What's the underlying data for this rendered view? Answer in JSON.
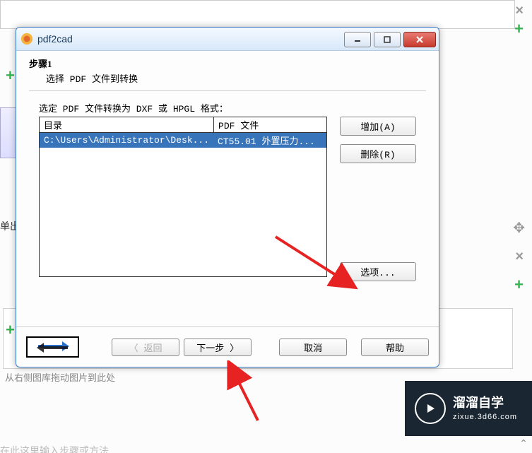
{
  "background": {
    "dropzone_hint": "从右侧图库拖动图片到此处",
    "bottom_hint": "在此这里输入步骤或方法",
    "left_text": "单出"
  },
  "dialog": {
    "title": "pdf2cad",
    "step_label": "步骤1",
    "step_desc": "选择 PDF 文件到转换",
    "instruction": "选定 PDF 文件转换为 DXF 或 HPGL 格式：",
    "table": {
      "col_dir": "目录",
      "col_file": "PDF 文件",
      "rows": [
        {
          "dir": "C:\\Users\\Administrator\\Desk...",
          "file": "CT55.01 外置压力..."
        }
      ]
    },
    "buttons": {
      "add": "增加(A)",
      "remove": "删除(R)",
      "options": "选项...",
      "back": "〈 返回",
      "next": "下一步 〉",
      "cancel": "取消",
      "help": "帮助"
    }
  },
  "watermark": {
    "cn": "溜溜自学",
    "en": "zixue.3d66.com"
  }
}
